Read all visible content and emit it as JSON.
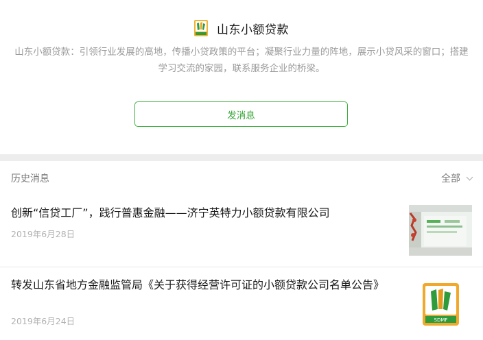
{
  "account": {
    "name": "山东小额贷款",
    "description": "山东小额贷款：引领行业发展的高地，传播小贷政策的平台；凝聚行业力量的阵地，展示小贷风采的窗口；搭建学习交流的家园，联系服务企业的桥梁。",
    "send_button": "发消息",
    "logo_icon": "sdmf-logo-icon",
    "accent_color": "#3fb03f"
  },
  "history": {
    "title": "历史消息",
    "filter": "全部",
    "articles": [
      {
        "title": "创新“信贷工厂”，践行普惠金融——济宁英特力小额贷款有限公司",
        "date": "2019年6月28日",
        "thumb_icon": "office-photo-icon"
      },
      {
        "title": "转发山东省地方金融监管局《关于获得经营许可证的小额贷款公司名单公告》",
        "date": "2019年6月24日",
        "thumb_icon": "sdmf-logo-icon",
        "thumb_label": "SDMF"
      }
    ]
  }
}
